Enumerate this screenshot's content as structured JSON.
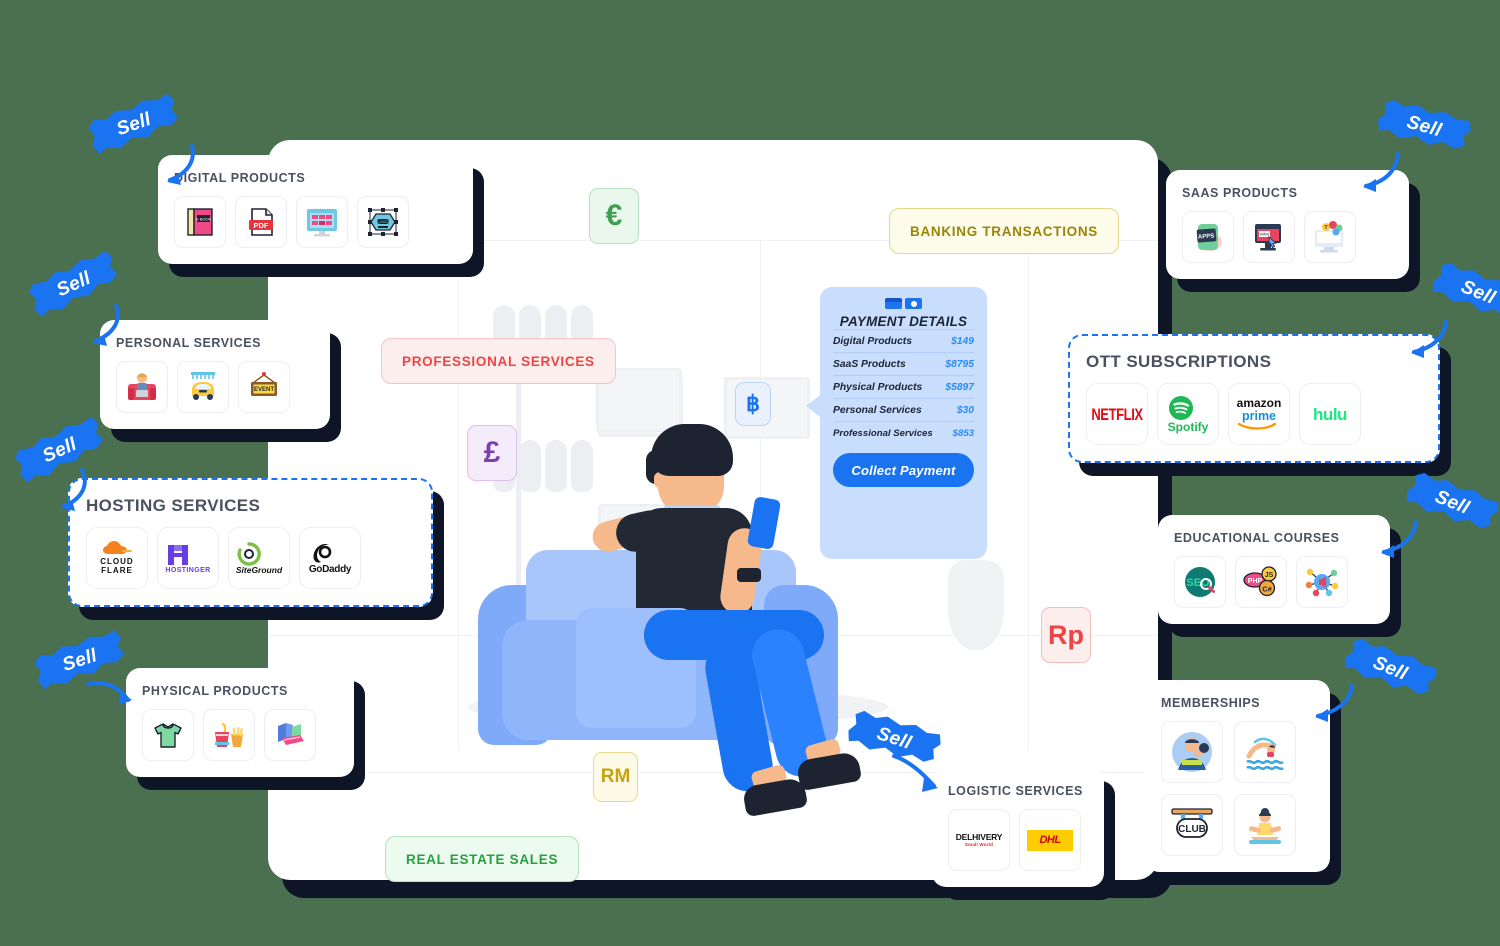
{
  "page": {
    "background_color": "#4a7050",
    "panel_color": "#ffffff",
    "shadow_color": "#0d1526",
    "accent_blue": "#1a73f0"
  },
  "payment_card": {
    "title": "PAYMENT DETAILS",
    "header_icon": "card-and-money-icon",
    "rows": [
      {
        "label": "Digital Products",
        "amount": "$149"
      },
      {
        "label": "SaaS Products",
        "amount": "$8795"
      },
      {
        "label": "Physical Products",
        "amount": "$5897"
      },
      {
        "label": "Personal Services",
        "amount": "$30"
      },
      {
        "label": "Professional Services",
        "amount": "$853"
      }
    ],
    "button_label": "Collect Payment",
    "bg_color": "#c9ddfd",
    "amount_color": "#2b8cf5",
    "button_color": "#1a73f0"
  },
  "cards": {
    "digital_products": {
      "title": "DIGITAL PRODUCTS",
      "tiles": [
        {
          "name": "ebook-icon",
          "label": "E-BOOK"
        },
        {
          "name": "pdf-icon",
          "label": "PDF"
        },
        {
          "name": "website-template-icon",
          "label": ""
        },
        {
          "name": "logo-design-icon",
          "label": "LOGO"
        }
      ]
    },
    "personal_services": {
      "title": "PERSONAL SERVICES",
      "tiles": [
        {
          "name": "freelancer-icon",
          "label": ""
        },
        {
          "name": "car-wash-icon",
          "label": ""
        },
        {
          "name": "event-sign-icon",
          "label": "EVENT"
        }
      ]
    },
    "hosting_services": {
      "title": "HOSTING SERVICES",
      "tiles": [
        {
          "name": "cloudflare-logo",
          "label": "CLOUD FLARE"
        },
        {
          "name": "hostinger-logo",
          "label": "HOSTINGER"
        },
        {
          "name": "siteground-logo",
          "label": "SiteGround"
        },
        {
          "name": "godaddy-logo",
          "label": "GoDaddy"
        }
      ]
    },
    "physical_products": {
      "title": "PHYSICAL PRODUCTS",
      "tiles": [
        {
          "name": "tshirt-icon",
          "label": ""
        },
        {
          "name": "food-combo-icon",
          "label": ""
        },
        {
          "name": "books-icon",
          "label": ""
        }
      ]
    },
    "saas_products": {
      "title": "SAAS PRODUCTS",
      "tiles": [
        {
          "name": "mobile-apps-icon",
          "label": "APPS"
        },
        {
          "name": "web-app-icon",
          "label": ""
        },
        {
          "name": "cloud-software-icon",
          "label": ""
        }
      ]
    },
    "ott_subscriptions": {
      "title": "OTT SUBSCRIPTIONS",
      "tiles": [
        {
          "name": "netflix-logo",
          "label": "NETFLIX"
        },
        {
          "name": "spotify-logo",
          "label": "Spotify"
        },
        {
          "name": "amazon-prime-logo",
          "label": "amazon",
          "label2": "prime"
        },
        {
          "name": "hulu-logo",
          "label": "hulu"
        }
      ]
    },
    "educational_courses": {
      "title": "EDUCATIONAL COURSES",
      "tiles": [
        {
          "name": "seo-course-icon",
          "label": "SEO"
        },
        {
          "name": "programming-course-icon",
          "label": "PHP JS C#"
        },
        {
          "name": "digital-marketing-icon",
          "label": ""
        }
      ]
    },
    "memberships": {
      "title": "MEMBERSHIPS",
      "tiles": [
        {
          "name": "gym-icon",
          "label": ""
        },
        {
          "name": "swimming-icon",
          "label": ""
        },
        {
          "name": "club-sign-icon",
          "label": "CLUB"
        },
        {
          "name": "yoga-icon",
          "label": ""
        }
      ]
    },
    "logistic_services": {
      "title": "LOGISTIC SERVICES",
      "tiles": [
        {
          "name": "delhivery-logo",
          "label": "DELHIVERY",
          "label2": "Small World"
        },
        {
          "name": "dhl-logo",
          "label": "DHL"
        }
      ]
    }
  },
  "currency_chips": [
    {
      "name": "euro-chip",
      "symbol": "€",
      "color": "#3f9e52",
      "bg": "#eaf7ec",
      "border": "#b6e0bf"
    },
    {
      "name": "pound-chip",
      "symbol": "£",
      "color": "#7b3fb0",
      "bg": "#f5ecfb",
      "border": "#dcc0ef"
    },
    {
      "name": "baht-chip",
      "symbol": "฿",
      "color": "#1a73f0",
      "bg": "#eaf1fe",
      "border": "#bcd4fb"
    },
    {
      "name": "ringgit-chip",
      "symbol": "RM",
      "color": "#c7a20d",
      "bg": "#fdfae8",
      "border": "#ead98a"
    },
    {
      "name": "rupiah-chip",
      "symbol": "Rp",
      "color": "#ef4444",
      "bg": "#fdeeee",
      "border": "#f5bcbc"
    }
  ],
  "category_tags": [
    {
      "name": "professional-services-tag",
      "label": "PROFESSIONAL SERVICES",
      "color": "#ef4444",
      "bg": "#fdeeee",
      "border": "#f6c4c4"
    },
    {
      "name": "banking-transactions-tag",
      "label": "BANKING TRANSACTIONS",
      "color": "#9a8508",
      "bg": "#fdfbe9",
      "border": "#e4d88c"
    },
    {
      "name": "real-estate-sales-tag",
      "label": "REAL ESTATE SALES",
      "color": "#27a03f",
      "bg": "#edfaef",
      "border": "#b6e2bf"
    }
  ],
  "sell_ribbons": {
    "label": "Sell",
    "count": 8,
    "color": "#1a73f0"
  }
}
